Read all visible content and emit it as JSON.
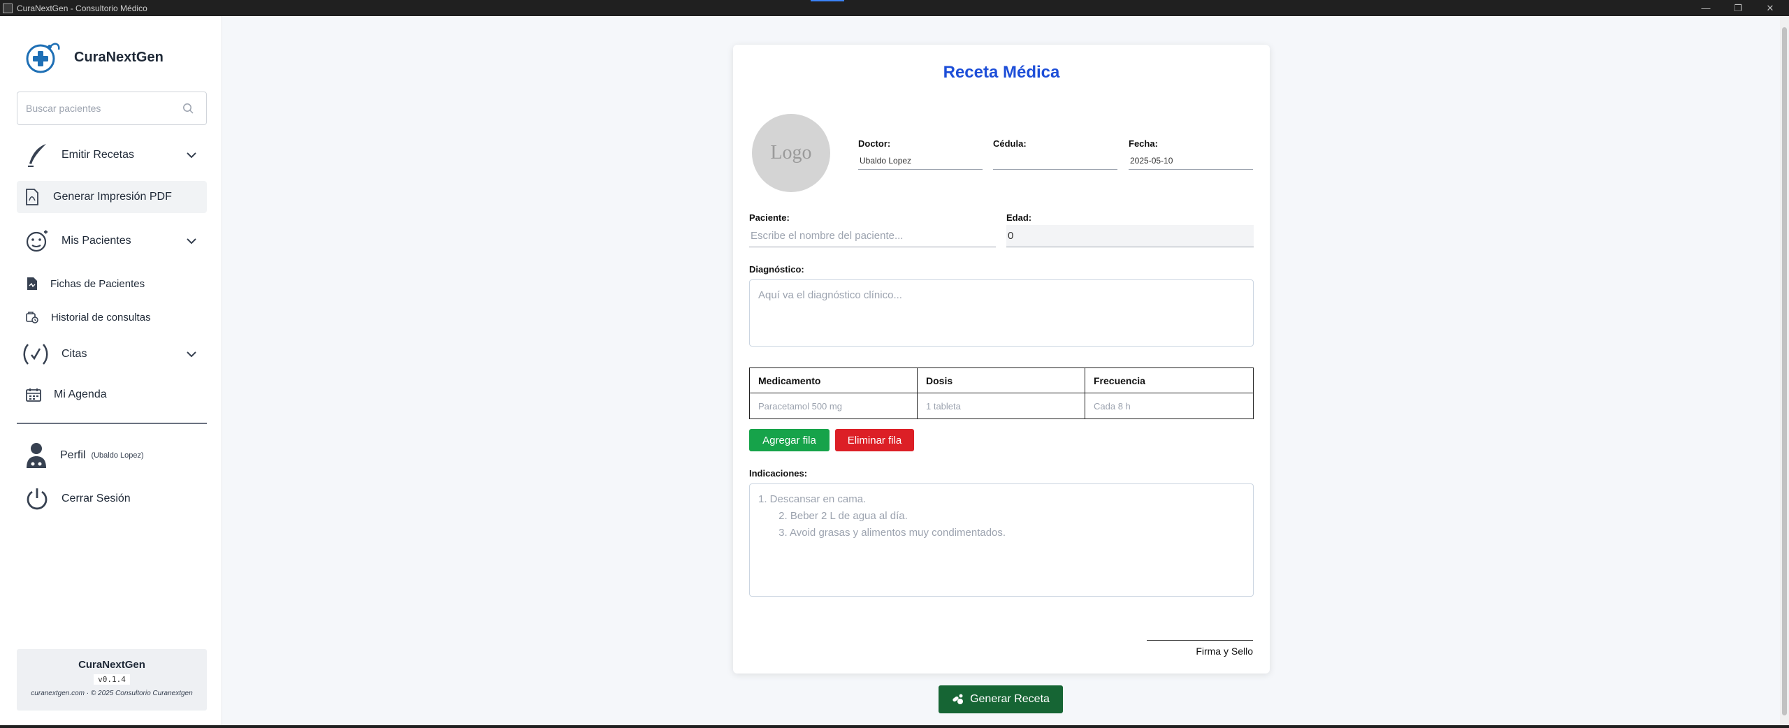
{
  "window": {
    "title": "CuraNextGen - Consultorio Médico",
    "minimize": "—",
    "maximize": "❐",
    "close": "✕"
  },
  "sidebar": {
    "brand": "CuraNextGen",
    "search_placeholder": "Buscar pacientes",
    "items": [
      {
        "label": "Emitir Recetas",
        "icon": "quill-pen-icon",
        "expandable": true
      },
      {
        "label": "Generar Impresión PDF",
        "icon": "pdf-file-icon",
        "active": true
      },
      {
        "label": "Mis Pacientes",
        "icon": "patient-face-icon",
        "expandable": true
      },
      {
        "label": "Fichas de Pacientes",
        "icon": "patient-file-icon"
      },
      {
        "label": "Historial de consultas",
        "icon": "history-icon"
      },
      {
        "label": "Citas",
        "icon": "appointments-icon",
        "expandable": true
      },
      {
        "label": "Mi Agenda",
        "icon": "calendar-icon"
      }
    ],
    "profile": {
      "label": "Perfil",
      "user": "(Ubaldo Lopez)"
    },
    "logout": "Cerrar Sesión",
    "footer": {
      "name": "CuraNextGen",
      "version": "v0.1.4",
      "copyright": "curanextgen.com · © 2025 Consultorio Curanextgen"
    }
  },
  "prescription": {
    "title": "Receta Médica",
    "logo_text": "Logo",
    "doctor_label": "Doctor:",
    "doctor_value": "Ubaldo Lopez",
    "cedula_label": "Cédula:",
    "cedula_value": "",
    "fecha_label": "Fecha:",
    "fecha_value": "2025-05-10",
    "paciente_label": "Paciente:",
    "paciente_placeholder": "Escribe el nombre del paciente...",
    "edad_label": "Edad:",
    "edad_value": "0",
    "diagnostico_label": "Diagnóstico:",
    "diagnostico_placeholder": "Aquí va el diagnóstico clínico...",
    "table": {
      "headers": [
        "Medicamento",
        "Dosis",
        "Frecuencia"
      ],
      "row_placeholders": [
        "Paracetamol 500 mg",
        "1 tableta",
        "Cada 8 h"
      ]
    },
    "add_row": "Agregar fila",
    "delete_row": "Eliminar fila",
    "indicaciones_label": "Indicaciones:",
    "indicaciones_placeholder": "1. Descansar en cama.\n       2. Beber 2 L de agua al día.\n       3. Avoid grasas y alimentos muy condimentados.",
    "signature_label": "Firma y Sello"
  },
  "generate_button": "Generar Receta",
  "colors": {
    "title_blue": "#1d4ed8",
    "add_green": "#16a34a",
    "delete_red": "#dc1f26",
    "generate_green": "#166534"
  }
}
